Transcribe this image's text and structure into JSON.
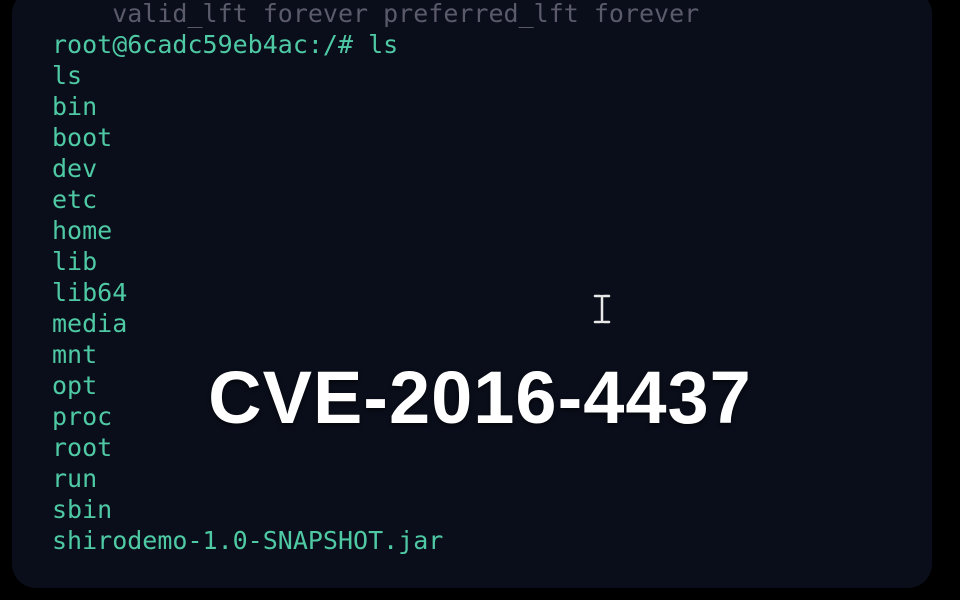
{
  "terminal": {
    "prompt": "root@6cadc59eb4ac:/# ",
    "command": "ls",
    "faded_prev": "    valid_lft forever preferred_lft forever",
    "echo": "ls",
    "entries": [
      "bin",
      "boot",
      "dev",
      "etc",
      "home",
      "lib",
      "lib64",
      "media",
      "mnt",
      "opt",
      "proc",
      "root",
      "run",
      "sbin",
      "shirodemo-1.0-SNAPSHOT.jar"
    ]
  },
  "overlay": {
    "title": "CVE-2016-4437"
  }
}
